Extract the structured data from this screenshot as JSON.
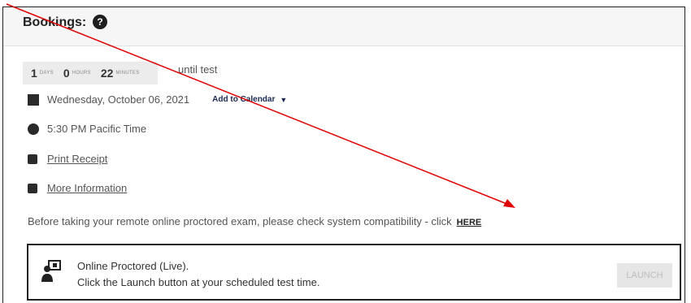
{
  "bookings": {
    "title": "Bookings:",
    "help_icon": "?",
    "countdown": [
      {
        "value": "1",
        "unit": "DAYS"
      },
      {
        "value": "0",
        "unit": "HOURS"
      },
      {
        "value": "22",
        "unit": "MINUTES"
      }
    ],
    "until_text": "until test",
    "date": "Wednesday, October 06, 2021",
    "add_to_calendar": "Add to Calendar",
    "time": "5:30 PM  Pacific Time",
    "print_receipt": "Print Receipt",
    "more_information": "More Information",
    "compat_text": "Before taking your remote online proctored exam, please check system compatibility - click",
    "here_link": "HERE",
    "session": {
      "title": "Online Proctored (Live).",
      "subtitle": "Click the Launch button at your scheduled test time.",
      "launch_label": "LAUNCH"
    }
  },
  "colors": {
    "annotation_arrow": "#e00000",
    "header_bg": "#f6f6f6"
  }
}
